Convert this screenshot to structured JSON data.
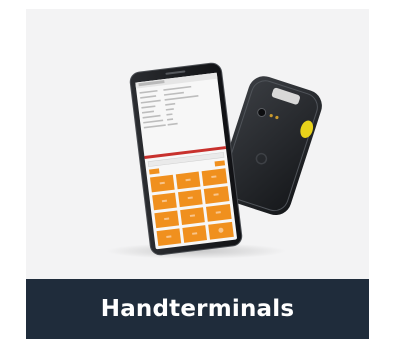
{
  "card": {
    "caption": "Handterminals",
    "caption_bg": "#1f2c3b",
    "background": "#f3f3f4"
  },
  "image": {
    "subject": "handheld-terminal",
    "keypad_color": "#f0901e",
    "accent_red": "#c8312d",
    "scanner_button_color": "#e8d21a"
  }
}
